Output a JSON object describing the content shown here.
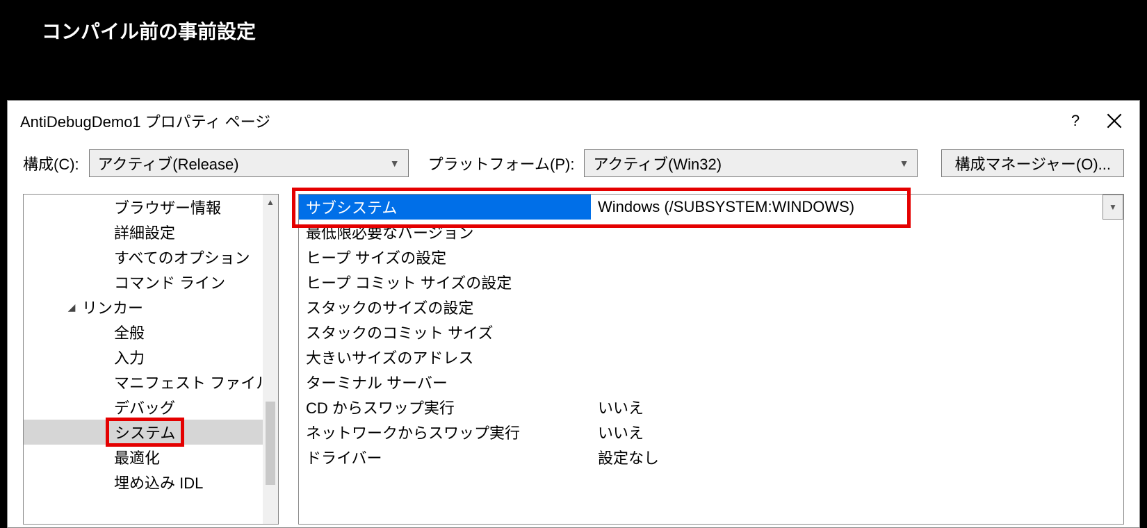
{
  "slide": {
    "title": "コンパイル前の事前設定"
  },
  "dialog": {
    "title": "AntiDebugDemo1 プロパティ ページ",
    "help_glyph": "?",
    "config_label": "構成(C):",
    "config_value": "アクティブ(Release)",
    "platform_label": "プラットフォーム(P):",
    "platform_value": "アクティブ(Win32)",
    "config_mgr_label": "構成マネージャー(O)..."
  },
  "tree": {
    "items": [
      {
        "label": "ブラウザー情報"
      },
      {
        "label": "詳細設定"
      },
      {
        "label": "すべてのオプション"
      },
      {
        "label": "コマンド ライン"
      }
    ],
    "linker_label": "リンカー",
    "linker_children": [
      {
        "label": "全般"
      },
      {
        "label": "入力"
      },
      {
        "label": "マニフェスト ファイル"
      },
      {
        "label": "デバッグ"
      },
      {
        "label": "システム",
        "selected": true,
        "highlighted": true
      },
      {
        "label": "最適化"
      },
      {
        "label": "埋め込み IDL"
      }
    ]
  },
  "grid": {
    "rows": [
      {
        "name": "サブシステム",
        "value": "Windows (/SUBSYSTEM:WINDOWS)",
        "selected": true,
        "dropdown": true,
        "highlighted": true
      },
      {
        "name": "最低限必要なバージョン",
        "value": ""
      },
      {
        "name": "ヒープ サイズの設定",
        "value": ""
      },
      {
        "name": "ヒープ コミット サイズの設定",
        "value": ""
      },
      {
        "name": "スタックのサイズの設定",
        "value": ""
      },
      {
        "name": "スタックのコミット サイズ",
        "value": ""
      },
      {
        "name": "大きいサイズのアドレス",
        "value": ""
      },
      {
        "name": "ターミナル サーバー",
        "value": ""
      },
      {
        "name": "CD からスワップ実行",
        "value": "いいえ"
      },
      {
        "name": "ネットワークからスワップ実行",
        "value": "いいえ"
      },
      {
        "name": "ドライバー",
        "value": "設定なし"
      }
    ]
  }
}
